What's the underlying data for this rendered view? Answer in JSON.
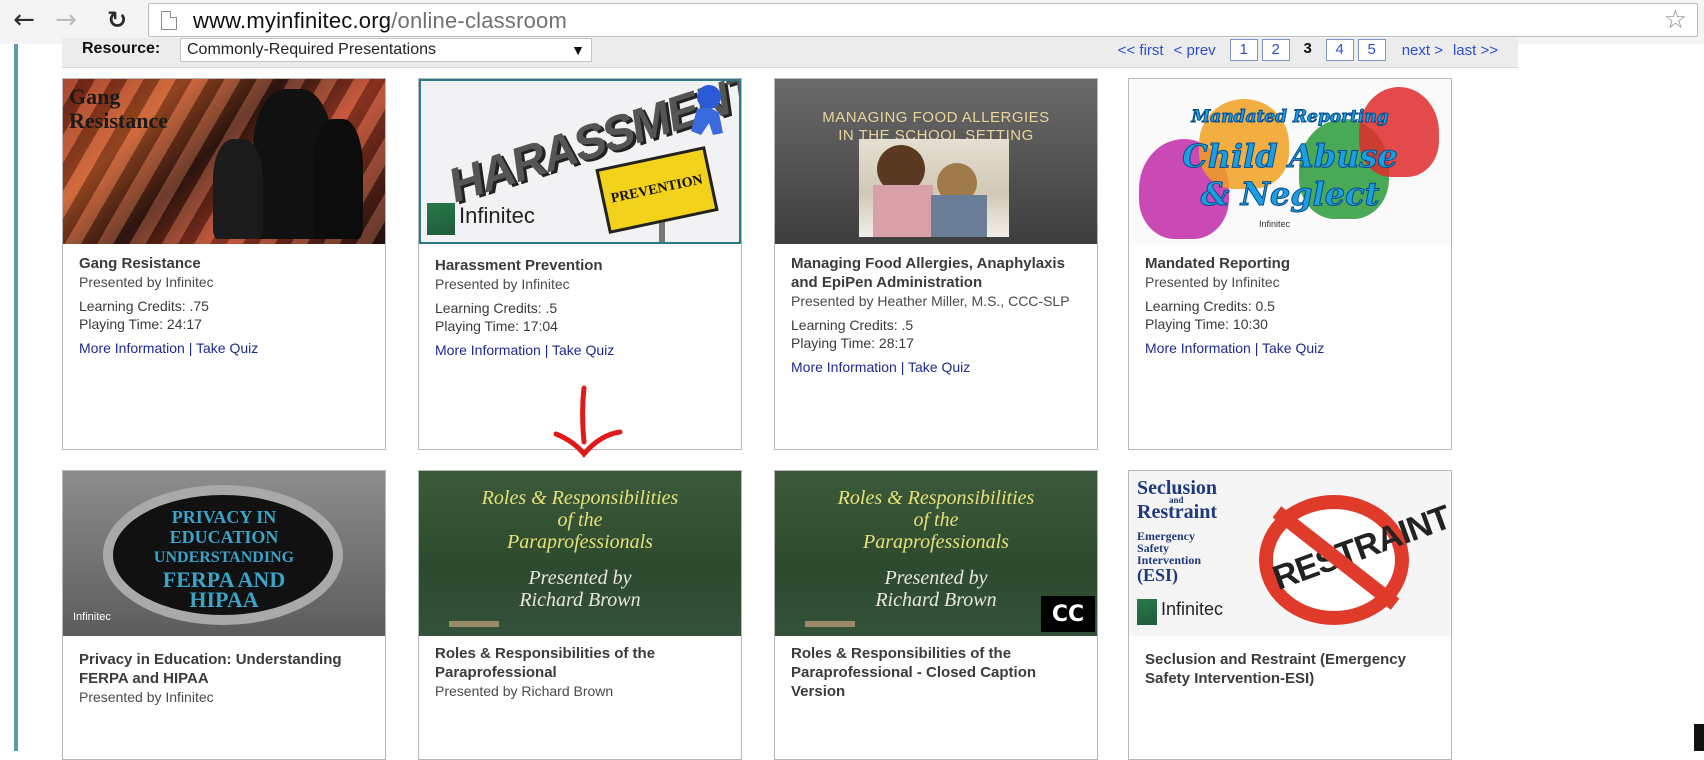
{
  "browser": {
    "url_host": "www.myinfinitec.org",
    "url_path": "/online-classroom",
    "icons": [
      "back-arrow-icon",
      "forward-arrow-icon",
      "reload-icon",
      "page-icon",
      "bookmark-star-icon"
    ]
  },
  "toolbar": {
    "resource_label": "Resource:",
    "resource_value": "Commonly-Required Presentations"
  },
  "pager": {
    "first": "<< first",
    "prev": "< prev",
    "pages": [
      "1",
      "2",
      "3",
      "4",
      "5"
    ],
    "current": "3",
    "next": "next >",
    "last": "last >>"
  },
  "cards": [
    {
      "title": "Gang Resistance",
      "presenter": "Presented by Infinitec",
      "credits": "Learning Credits: .75",
      "time": "Playing Time: 24:17",
      "more": "More Information",
      "sep": " | ",
      "quiz": "Take Quiz",
      "thumb_text": [
        "Gang",
        "Resistance"
      ]
    },
    {
      "title": "Harassment Prevention",
      "presenter": "Presented by Infinitec",
      "credits": "Learning Credits: .5",
      "time": "Playing Time: 17:04",
      "more": "More Information",
      "sep": " | ",
      "quiz": "Take Quiz",
      "thumb_text": [
        "HARASSMENT",
        "PREVENTION",
        "Infinitec"
      ]
    },
    {
      "title": "Managing Food Allergies, Anaphylaxis and EpiPen Administration",
      "presenter": "Presented by Heather Miller, M.S., CCC-SLP",
      "credits": "Learning Credits: .5",
      "time": "Playing Time: 28:17",
      "more": "More Information",
      "sep": " | ",
      "quiz": "Take Quiz",
      "thumb_text": [
        "MANAGING FOOD ALLERGIES",
        "IN THE SCHOOL SETTING"
      ]
    },
    {
      "title": "Mandated Reporting",
      "presenter": "Presented by Infinitec",
      "credits": "Learning Credits: 0.5",
      "time": "Playing Time: 10:30",
      "more": "More Information",
      "sep": " | ",
      "quiz": "Take Quiz",
      "thumb_text": [
        "Mandated Reporting",
        "Child Abuse",
        "& Neglect",
        "Infinitec"
      ]
    },
    {
      "title": "Privacy in Education: Understanding FERPA and HIPAA",
      "presenter": "Presented by Infinitec",
      "thumb_text": [
        "PRIVACY IN",
        "EDUCATION",
        "UNDERSTANDING",
        "FERPA AND",
        "HIPAA",
        "Infinitec"
      ]
    },
    {
      "title": "Roles & Responsibilities of the Paraprofessional",
      "presenter": "Presented by Richard Brown",
      "thumb_text": [
        "Roles & Responsibilities",
        "of the",
        "Paraprofessionals",
        "Presented by",
        "Richard Brown"
      ]
    },
    {
      "title": "Roles & Responsibilities of the Paraprofessional - Closed Caption Version",
      "thumb_text": [
        "Roles & Responsibilities",
        "of the",
        "Paraprofessionals",
        "Presented by",
        "Richard Brown",
        "CC"
      ]
    },
    {
      "title": "Seclusion and Restraint (Emergency Safety Intervention-ESI)",
      "thumb_text": [
        "Seclusion",
        "and",
        "Restraint",
        "Emergency",
        "Safety",
        "Intervention",
        "(ESI)",
        "RESTRAINT",
        "Infinitec"
      ]
    }
  ],
  "colors": {
    "link": "#1d2a8c",
    "pager_link": "#2c4fd1",
    "left_stripe": "#5aa0ab",
    "annotation_arrow": "#e01a1a"
  }
}
